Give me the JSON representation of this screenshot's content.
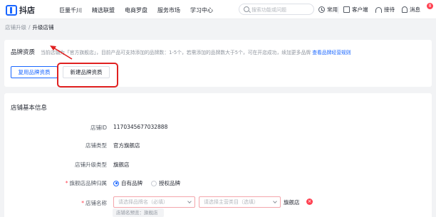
{
  "app": {
    "name": "抖店"
  },
  "nav": [
    "巨量千川",
    "精选联盟",
    "电商罗盘",
    "服务市场",
    "学习中心"
  ],
  "search": {
    "placeholder": "搜索功能或问题"
  },
  "tools": {
    "common": "常用",
    "service": "客户端",
    "feedback": "接待",
    "messages": "消息",
    "badge_count": "8"
  },
  "breadcrumb": {
    "parent": "店铺升级",
    "current": "升级店铺"
  },
  "brand": {
    "title": "品牌资质",
    "description": "当前店铺为「官方旗舰店」，目前产品可支持添加的品牌数：1-5个，若需添加的品牌数大于5个，可在开店成功，续加更多品牌",
    "link": "查看品牌经营规则",
    "reuse_button": "复用品牌资质",
    "new_button": "新建品牌资质"
  },
  "store": {
    "title": "店铺基本信息",
    "id_label": "店铺ID",
    "id_value": "1170345677032888",
    "type_label": "店铺类型",
    "type_value": "官方旗舰店",
    "upgrade_label": "店铺升级类型",
    "upgrade_value": "旗舰店",
    "brand_owner_label": "旗舰店品牌归属",
    "brand_owner_options": [
      "自有品牌",
      "授权品牌"
    ],
    "name_label": "店铺名称",
    "brand_select_placeholder": "请选择品牌名（必填）",
    "category_select_placeholder": "请选择主营类目（选填）",
    "name_suffix": "旗舰店",
    "name_preview": "店铺名预览：旗舰店"
  },
  "colors": {
    "accent": "#1966ff",
    "highlight": "#e02020",
    "required": "#ff4050"
  },
  "icons": [
    "logo-icon",
    "search-icon",
    "clock-icon",
    "client-icon",
    "headset-icon",
    "bell-icon",
    "close-icon",
    "chevron-down-icon"
  ]
}
